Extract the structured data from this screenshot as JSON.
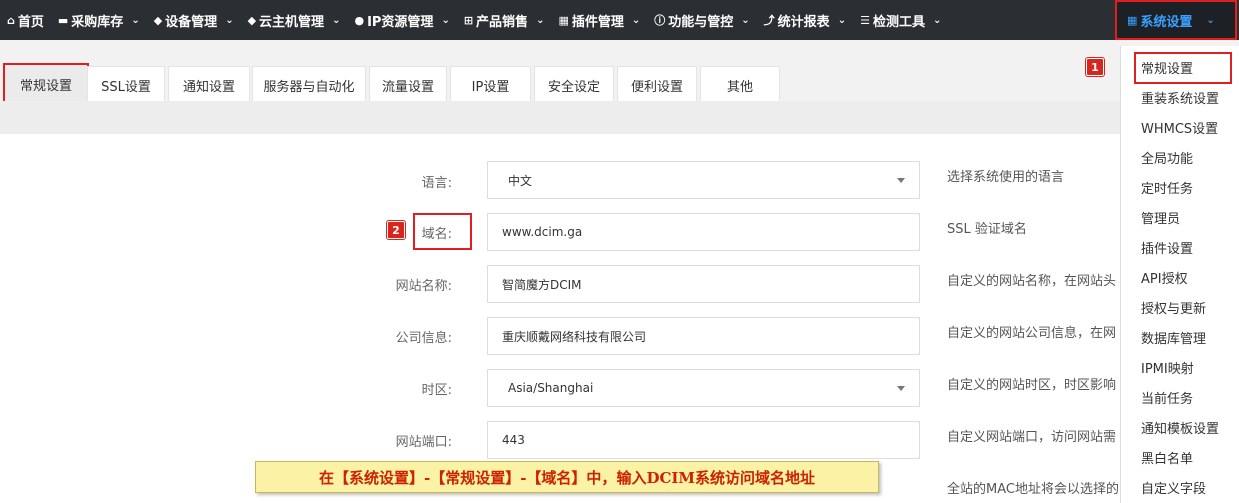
{
  "nav": {
    "items": [
      {
        "icon": "⌂",
        "label": "首页"
      },
      {
        "icon": "▬",
        "label": "采购库存"
      },
      {
        "icon": "◆",
        "label": "设备管理"
      },
      {
        "icon": "◆",
        "label": "云主机管理"
      },
      {
        "icon": "●",
        "label": "IP资源管理"
      },
      {
        "icon": "⊞",
        "label": "产品销售"
      },
      {
        "icon": "▦",
        "label": "插件管理"
      },
      {
        "icon": "ⓘ",
        "label": "功能与管控"
      },
      {
        "icon": "⤴",
        "label": "统计报表"
      },
      {
        "icon": "☰",
        "label": "检测工具"
      }
    ],
    "active": {
      "icon": "▦",
      "label": "系统设置"
    },
    "caret": "⌄"
  },
  "tabs": [
    "常规设置",
    "SSL设置",
    "通知设置",
    "服务器与自动化",
    "流量设置",
    "IP设置",
    "安全设定",
    "便利设置",
    "其他"
  ],
  "form": {
    "language": {
      "label": "语言:",
      "value": "中文",
      "help": "选择系统使用的语言"
    },
    "domain": {
      "label": "域名:",
      "value": "www.dcim.ga",
      "help": "SSL 验证域名"
    },
    "site_name": {
      "label": "网站名称:",
      "value": "智简魔方DCIM",
      "help": "自定义的网站名称，在网站头"
    },
    "company": {
      "label": "公司信息:",
      "value": "重庆顺戴网络科技有限公司",
      "help": "自定义的网站公司信息，在网"
    },
    "timezone": {
      "label": "时区:",
      "value": "Asia/Shanghai",
      "help": "自定义的网站时区，时区影响"
    },
    "port": {
      "label": "网站端口:",
      "value": "443",
      "help": "自定义网站端口，访问网站需"
    },
    "mac_help": "全站的MAC地址将会以选择的"
  },
  "dropdown": [
    "常规设置",
    "重装系统设置",
    "WHMCS设置",
    "全局功能",
    "定时任务",
    "管理员",
    "插件设置",
    "API授权",
    "授权与更新",
    "数据库管理",
    "IPMI映射",
    "当前任务",
    "通知模板设置",
    "黑白名单",
    "自定义字段"
  ],
  "markers": {
    "one": "1",
    "two": "2"
  },
  "caption": "在【系统设置】-【常规设置】-【域名】中，输入DCIM系统访问域名地址",
  "colors": {
    "nav_bg": "#2b2f33",
    "highlight": "#e02020",
    "active_link": "#3aa0ff",
    "caption_bg": "#fcf2a6",
    "caption_text": "#cc2200"
  }
}
